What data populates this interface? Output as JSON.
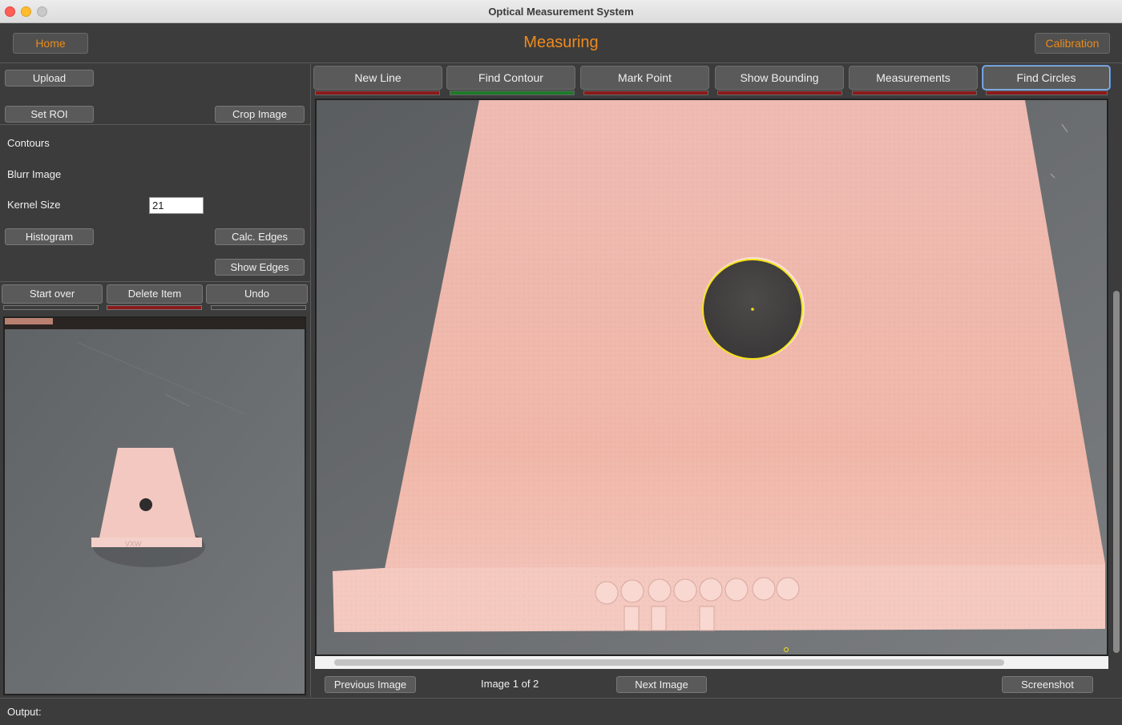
{
  "window": {
    "title": "Optical Measurement System"
  },
  "header": {
    "home_label": "Home",
    "title": "Measuring",
    "calibration_label": "Calibration"
  },
  "left_panel": {
    "upload_label": "Upload",
    "set_roi_label": "Set ROI",
    "crop_image_label": "Crop Image",
    "contours_label": "Contours",
    "blurr_image_label": "Blurr Image",
    "kernel_size_label": "Kernel Size",
    "kernel_size_value": "21",
    "histogram_label": "Histogram",
    "calc_edges_label": "Calc. Edges",
    "show_edges_label": "Show Edges",
    "actions": [
      {
        "label": "Start over",
        "indicator_color": "#3c3c3c"
      },
      {
        "label": "Delete Item",
        "indicator_color": "#8b1a1a"
      },
      {
        "label": "Undo",
        "indicator_color": "#3c3c3c"
      }
    ]
  },
  "toolbar": {
    "tools": [
      {
        "label": "New Line",
        "indicator_color": "#8b1a1a"
      },
      {
        "label": "Find Contour",
        "indicator_color": "#1e7a2a"
      },
      {
        "label": "Mark Point",
        "indicator_color": "#8b1a1a"
      },
      {
        "label": "Show Bounding",
        "indicator_color": "#8b1a1a"
      },
      {
        "label": "Measurements",
        "indicator_color": "#8b1a1a"
      },
      {
        "label": "Find Circles",
        "indicator_color": "#8b1a1a"
      }
    ],
    "active_tool": "Find Circles"
  },
  "navigation": {
    "previous_label": "Previous Image",
    "image_counter": "Image 1 of 2",
    "next_label": "Next Image",
    "screenshot_label": "Screenshot"
  },
  "status": {
    "output_label": "Output:"
  },
  "colors": {
    "accent": "#f08a1c",
    "indicator_off": "#8b1a1a",
    "indicator_on": "#1e7a2a",
    "part_color": "#f0b8ae",
    "detected_circle": "#f4e21a"
  }
}
